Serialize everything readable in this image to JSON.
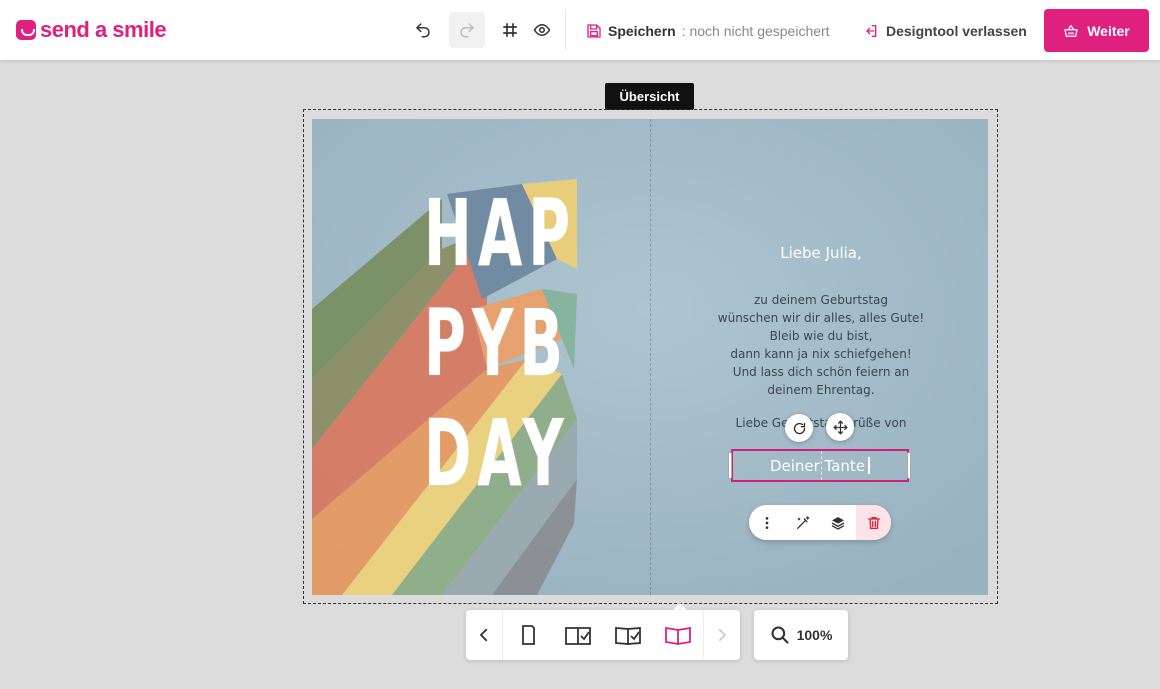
{
  "brand": {
    "name": "send a smile",
    "accent": "#e0207f"
  },
  "toolbar": {
    "undo_icon": "undo-icon",
    "redo_icon": "redo-icon",
    "grid_icon": "grid-icon",
    "preview_icon": "eye-icon",
    "save_label": "Speichern",
    "save_status": ": noch nicht gespeichert",
    "leave_label": "Designtool verlassen",
    "next_label": "Weiter"
  },
  "canvas": {
    "view_label": "Übersicht",
    "cover_text": [
      "HAP",
      "PYB",
      "DAY"
    ],
    "greeting": "Liebe Julia,",
    "body_lines": [
      "zu deinem Geburtstag",
      "wünschen wir dir alles, alles Gute!",
      "Bleib wie du bist,",
      "dann kann ja nix schiefgehen!",
      "Und lass dich schön feiern an",
      "deinem Ehrentag."
    ],
    "closing": "Liebe Geburtstagsgrüße von",
    "selected_text": "Deiner Tante"
  },
  "context_menu": {
    "more_icon": "more-vertical-icon",
    "effects_icon": "magic-wand-icon",
    "layers_icon": "layers-icon",
    "delete_icon": "trash-icon",
    "danger_color": "#e0203a"
  },
  "bottom_nav": {
    "active_view": "inside",
    "zoom": "100%"
  }
}
